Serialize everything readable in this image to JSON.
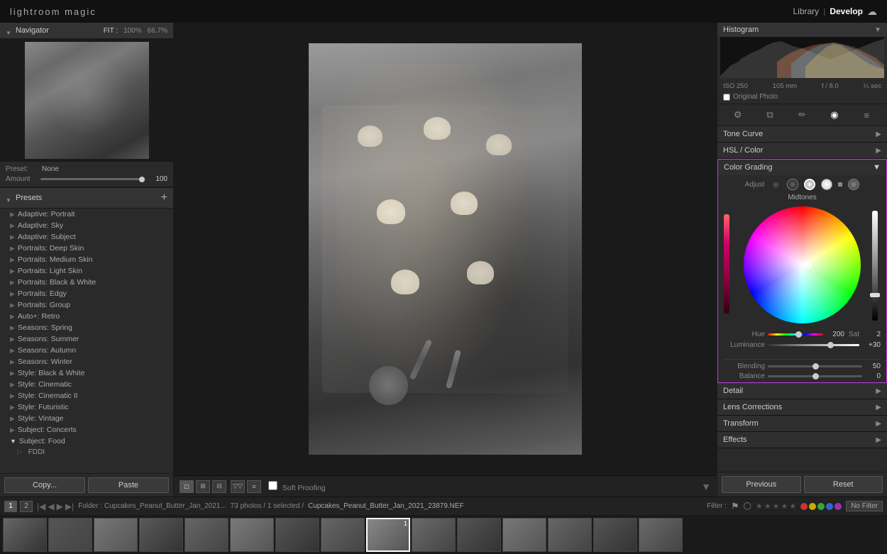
{
  "app": {
    "logo": "lightroom magic",
    "nav": {
      "library": "Library",
      "separator": "|",
      "develop": "Develop"
    }
  },
  "left_panel": {
    "navigator": {
      "title": "Navigator",
      "fit_options": [
        "FIT:",
        "100%",
        "66.7%"
      ]
    },
    "preset": {
      "label": "Preset:",
      "value": "None",
      "amount_label": "Amount",
      "amount_value": "100"
    },
    "presets": {
      "title": "Presets",
      "items": [
        {
          "label": "Adaptive: Portrait",
          "type": "group"
        },
        {
          "label": "Adaptive: Sky",
          "type": "group"
        },
        {
          "label": "Adaptive: Subject",
          "type": "group"
        },
        {
          "label": "Portraits: Deep Skin",
          "type": "group"
        },
        {
          "label": "Portraits: Medium Skin",
          "type": "group"
        },
        {
          "label": "Portraits: Light Skin",
          "type": "group"
        },
        {
          "label": "Portraits: Black & White",
          "type": "group"
        },
        {
          "label": "Portraits: Edgy",
          "type": "group"
        },
        {
          "label": "Portraits: Group",
          "type": "group"
        },
        {
          "label": "Auto+: Retro",
          "type": "group"
        },
        {
          "label": "Seasons: Spring",
          "type": "group"
        },
        {
          "label": "Seasons: Summer",
          "type": "group"
        },
        {
          "label": "Seasons: Autumn",
          "type": "group"
        },
        {
          "label": "Seasons: Winter",
          "type": "group"
        },
        {
          "label": "Style: Black & White",
          "type": "group"
        },
        {
          "label": "Style: Cinematic",
          "type": "group"
        },
        {
          "label": "Style: Cinematic II",
          "type": "group"
        },
        {
          "label": "Style: Futuristic",
          "type": "group"
        },
        {
          "label": "Style: Vintage",
          "type": "group"
        },
        {
          "label": "Subject: Concerts",
          "type": "group"
        },
        {
          "label": "Subject: Food",
          "type": "expanded"
        },
        {
          "label": "FDDI",
          "type": "child"
        }
      ],
      "copy_label": "Copy...",
      "paste_label": "Paste"
    }
  },
  "toolbar": {
    "view_options": [
      "□",
      "⊞",
      "⊟"
    ],
    "soft_proofing": "Soft Proofing",
    "dropdown_arrow": "▼"
  },
  "right_panel": {
    "histogram": {
      "title": "Histogram",
      "iso": "ISO 250",
      "focal": "105 mm",
      "aperture": "f / 8.0",
      "shutter": "¼ sec",
      "original_photo": "Original Photo"
    },
    "sections": [
      {
        "title": "Tone Curve",
        "expanded": false
      },
      {
        "title": "HSL / Color",
        "expanded": false
      },
      {
        "title": "Color Grading",
        "expanded": true
      },
      {
        "title": "Detail",
        "expanded": false
      },
      {
        "title": "Lens Corrections",
        "expanded": false
      },
      {
        "title": "Transform",
        "expanded": false
      },
      {
        "title": "Effects",
        "expanded": false
      }
    ],
    "color_grading": {
      "title": "Color Grading",
      "adjust_label": "Adjust",
      "wheel_label": "Midtones",
      "hue": {
        "label": "Hue",
        "value": "200",
        "pct": 55
      },
      "sat": {
        "label": "Sat",
        "value": "2",
        "pct": 51
      },
      "luminance": {
        "label": "Luminance",
        "value": "+30",
        "pct": 68
      },
      "blending": {
        "label": "Blending",
        "value": "50",
        "pct": 50
      },
      "balance": {
        "label": "Balance",
        "value": "0",
        "pct": 50
      }
    },
    "buttons": {
      "previous": "Previous",
      "reset": "Reset"
    }
  },
  "bottom_bar": {
    "pages": [
      "1",
      "2"
    ],
    "folder_label": "Folder : Cupcakes_Peanut_Butter_Jan_2021...",
    "count": "73 photos / 1 selected /",
    "path": "Cupcakes_Peanut_Butter_Jan_2021_23879.NEF",
    "filter_label": "Filter :",
    "no_filter": "No Filter"
  },
  "icons": {
    "triangle_down": "▼",
    "triangle_right": "▶",
    "triangle_left": "◀",
    "plus": "+",
    "gear": "⚙",
    "copy_tool": "⧉",
    "brush": "✏",
    "eye": "◉",
    "settings": "≡",
    "chevron_down": "▾",
    "link": "⊕"
  }
}
